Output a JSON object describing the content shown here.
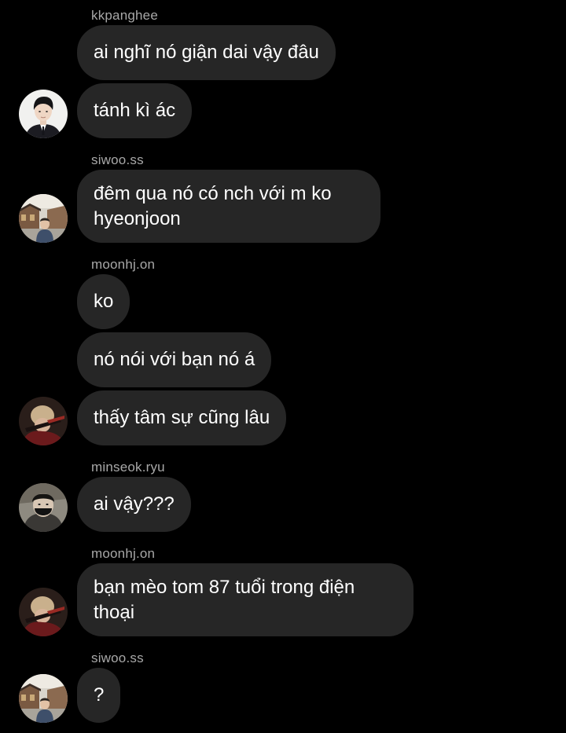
{
  "colors": {
    "background": "#000000",
    "bubble": "#262626",
    "sender_name": "#a8a8a8",
    "message_text": "#ffffff"
  },
  "messages": [
    {
      "sender": "kkpanghee",
      "text": "ai nghĩ nó giận dai vậy đâu"
    },
    {
      "text": "tánh kì ác",
      "avatar": "kkpanghee-avatar"
    },
    {
      "sender": "siwoo.ss",
      "text": "đêm qua nó có nch với m ko hyeonjoon",
      "avatar": "siwoo-avatar"
    },
    {
      "sender": "moonhj.on",
      "text": "ko"
    },
    {
      "text": "nó nói với bạn nó á"
    },
    {
      "text": "thấy tâm sự cũng lâu",
      "avatar": "moonhj-avatar"
    },
    {
      "sender": "minseok.ryu",
      "text": "ai vậy???",
      "avatar": "minseok-avatar"
    },
    {
      "sender": "moonhj.on",
      "text": "bạn mèo tom 87 tuổi trong điện thoại",
      "avatar": "moonhj-avatar"
    },
    {
      "sender": "siwoo.ss",
      "text": "?",
      "avatar": "siwoo-avatar"
    }
  ]
}
